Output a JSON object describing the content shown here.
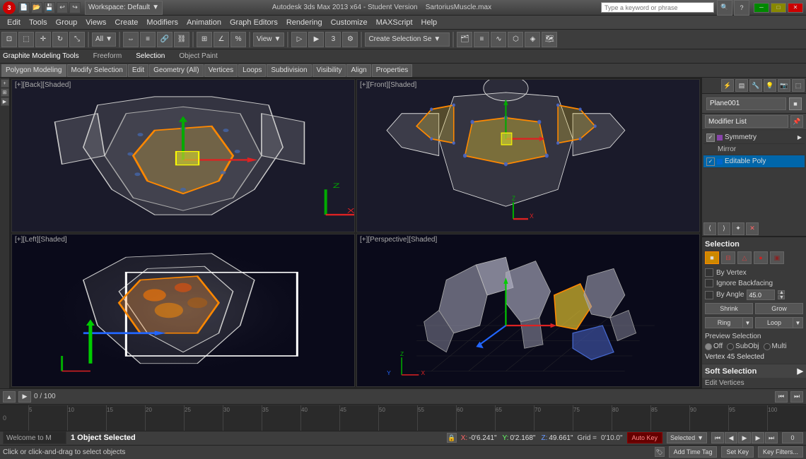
{
  "titlebar": {
    "logo": "3",
    "workspace": "Workspace: Default",
    "title": "Autodesk 3ds Max 2013 x64 - Student Version",
    "filename": "SartoriusMuscle.max",
    "search_placeholder": "Type a keyword or phrase"
  },
  "menubar": {
    "items": [
      "Edit",
      "Tools",
      "Group",
      "Views",
      "Create",
      "Modifiers",
      "Animation",
      "Graph Editors",
      "Rendering",
      "Customize",
      "MAXScript",
      "Help"
    ]
  },
  "toolbar": {
    "undo_label": "↩",
    "redo_label": "↪",
    "select_label": "⊡",
    "view_dropdown": "View",
    "viewport_shading": "Shaded",
    "create_sel_btn": "Create Selection Se"
  },
  "graphite_tools": {
    "sections": [
      "Graphite Modeling Tools",
      "Freeform",
      "Selection",
      "Object Paint"
    ]
  },
  "sub_toolbar": {
    "items": [
      "Polygon Modeling",
      "Modify Selection",
      "Edit",
      "Geometry (All)",
      "Vertices",
      "Loops",
      "Subdivision",
      "Visibility",
      "Align",
      "Properties"
    ]
  },
  "viewports": {
    "back": {
      "label": "[+][Back][Shaded]"
    },
    "front": {
      "label": "[+][Front][Shaded]"
    },
    "left": {
      "label": "[+][Left][Shaded]"
    },
    "perspective": {
      "label": "[+][Perspective][Shaded]"
    }
  },
  "right_panel": {
    "object_name": "Plane001",
    "modifier_list_label": "Modifier List",
    "modifiers": [
      {
        "name": "Symmetry",
        "sub": "Mirror",
        "active": false
      },
      {
        "name": "Editable Poly",
        "active": true
      }
    ]
  },
  "selection_panel": {
    "title": "Selection",
    "icons": [
      "■",
      "·",
      "△",
      "●",
      "▣"
    ],
    "by_vertex": "By Vertex",
    "ignore_backfacing": "Ignore Backfacing",
    "by_angle": "By Angle",
    "angle_value": "45.0",
    "shrink": "Shrink",
    "grow": "Grow",
    "ring": "Ring",
    "loop": "Loop",
    "preview_selection": "Preview Selection",
    "off": "Off",
    "subobj": "SubObj",
    "multi": "Multi",
    "vertex_selected": "Vertex 45 Selected"
  },
  "soft_selection": {
    "title": "Soft Selection"
  },
  "timeline": {
    "progress": "0 / 100",
    "marks": [
      "0",
      "5",
      "10",
      "15",
      "20",
      "25",
      "30",
      "35",
      "40",
      "45",
      "50",
      "55",
      "60",
      "65",
      "70",
      "75",
      "80",
      "85",
      "90",
      "95",
      "100"
    ]
  },
  "statusbar": {
    "selected": "1 Object Selected",
    "hint": "Click or click-and-drag to select objects",
    "x_label": "X:",
    "x_val": "-0'6.241\"",
    "y_label": "Y:",
    "y_val": "0'2.168\"",
    "z_label": "Z:",
    "z_val": "49.661\"",
    "grid_label": "Grid =",
    "grid_val": "0'10.0\"",
    "autokey": "Auto Key",
    "selected_mode": "Selected",
    "set_key": "Set Key",
    "key_filters": "Key Filters...",
    "add_time_tag": "Add Time Tag"
  },
  "welcome": {
    "text": "Welcome to M"
  }
}
